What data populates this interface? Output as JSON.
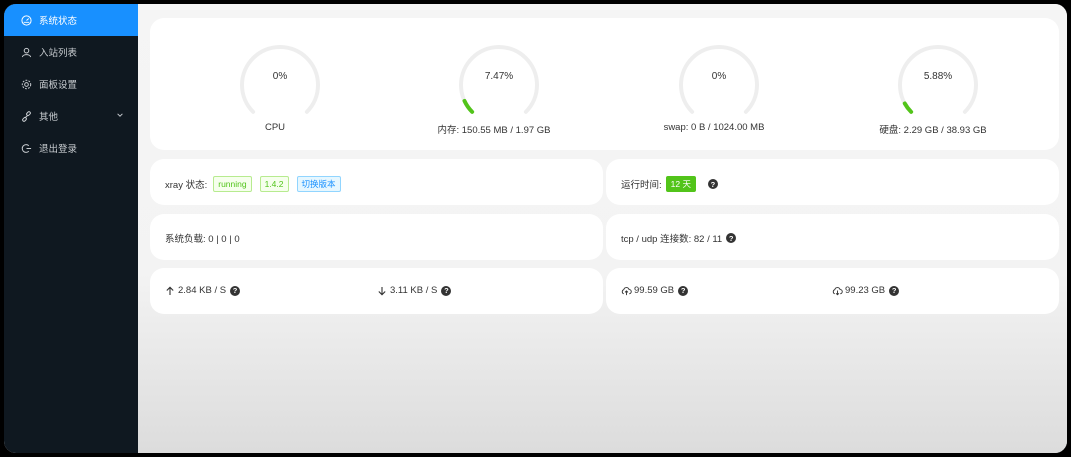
{
  "sidebar": {
    "items": [
      {
        "label": "系统状态",
        "icon": "dashboard-icon",
        "active": true
      },
      {
        "label": "入站列表",
        "icon": "user-icon",
        "active": false
      },
      {
        "label": "面板设置",
        "icon": "gear-icon",
        "active": false
      },
      {
        "label": "其他",
        "icon": "link-icon",
        "active": false,
        "has_submenu": true
      },
      {
        "label": "退出登录",
        "icon": "logout-icon",
        "active": false
      }
    ]
  },
  "gauges": [
    {
      "name": "cpu",
      "percent_text": "0%",
      "percent": 0,
      "label": "CPU"
    },
    {
      "name": "memory",
      "percent_text": "7.47%",
      "percent": 7.47,
      "label": "内存: 150.55 MB / 1.97 GB"
    },
    {
      "name": "swap",
      "percent_text": "0%",
      "percent": 0,
      "label": "swap: 0 B / 1024.00 MB"
    },
    {
      "name": "disk",
      "percent_text": "5.88%",
      "percent": 5.88,
      "label": "硬盘: 2.29 GB / 38.93 GB"
    }
  ],
  "xray": {
    "label": "xray 状态:",
    "status": "running",
    "version": "1.4.2",
    "switch_label": "切换版本"
  },
  "uptime": {
    "label": "运行时间:",
    "value": "12 天"
  },
  "load": {
    "label": "系统负载: 0 | 0 | 0"
  },
  "connections": {
    "label": "tcp / udp 连接数: 82 / 11"
  },
  "speed": {
    "upload": "2.84 KB / S",
    "download": "3.11 KB / S"
  },
  "traffic": {
    "sent": "99.59 GB",
    "received": "99.23 GB"
  },
  "help_glyph": "?",
  "colors": {
    "accent": "#1890ff",
    "sidebar_bg": "#0f1820",
    "gauge_track": "#eeeeee",
    "gauge_fill": "#52c41a"
  }
}
